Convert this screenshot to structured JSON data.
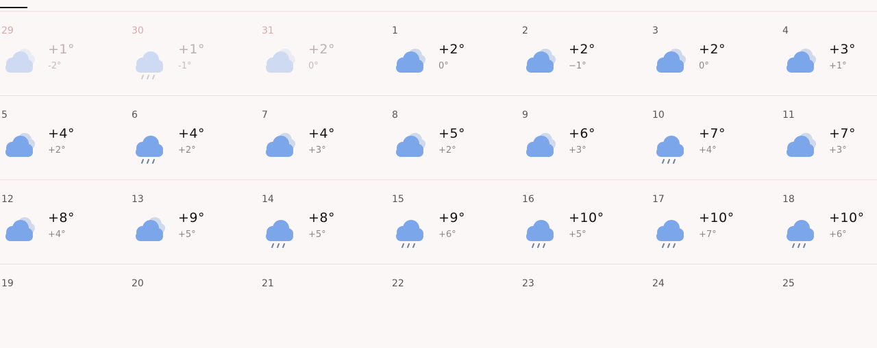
{
  "weeks": [
    [
      {
        "day": "29",
        "max": "+1°",
        "min": "-2°",
        "icon": "cloudy-icon",
        "past": true
      },
      {
        "day": "30",
        "max": "+1°",
        "min": "-1°",
        "icon": "rain-cloud-icon",
        "past": true
      },
      {
        "day": "31",
        "max": "+2°",
        "min": "0°",
        "icon": "cloudy-icon",
        "past": true
      },
      {
        "day": "1",
        "max": "+2°",
        "min": "0°",
        "icon": "cloudy-icon",
        "past": false
      },
      {
        "day": "2",
        "max": "+2°",
        "min": "−1°",
        "icon": "cloudy-icon",
        "past": false
      },
      {
        "day": "3",
        "max": "+2°",
        "min": "0°",
        "icon": "cloudy-icon",
        "past": false
      },
      {
        "day": "4",
        "max": "+3°",
        "min": "+1°",
        "icon": "cloudy-icon",
        "past": false
      }
    ],
    [
      {
        "day": "5",
        "max": "+4°",
        "min": "+2°",
        "icon": "cloudy-icon",
        "past": false
      },
      {
        "day": "6",
        "max": "+4°",
        "min": "+2°",
        "icon": "rain-cloud-icon",
        "past": false
      },
      {
        "day": "7",
        "max": "+4°",
        "min": "+3°",
        "icon": "cloudy-icon",
        "past": false
      },
      {
        "day": "8",
        "max": "+5°",
        "min": "+2°",
        "icon": "cloudy-icon",
        "past": false
      },
      {
        "day": "9",
        "max": "+6°",
        "min": "+3°",
        "icon": "cloudy-icon",
        "past": false
      },
      {
        "day": "10",
        "max": "+7°",
        "min": "+4°",
        "icon": "rain-cloud-icon",
        "past": false
      },
      {
        "day": "11",
        "max": "+7°",
        "min": "+3°",
        "icon": "cloudy-icon",
        "past": false
      }
    ],
    [
      {
        "day": "12",
        "max": "+8°",
        "min": "+4°",
        "icon": "cloudy-icon",
        "past": false
      },
      {
        "day": "13",
        "max": "+9°",
        "min": "+5°",
        "icon": "cloudy-icon",
        "past": false
      },
      {
        "day": "14",
        "max": "+8°",
        "min": "+5°",
        "icon": "rain-cloud-icon",
        "past": false
      },
      {
        "day": "15",
        "max": "+9°",
        "min": "+6°",
        "icon": "rain-cloud-icon",
        "past": false
      },
      {
        "day": "16",
        "max": "+10°",
        "min": "+5°",
        "icon": "rain-cloud-icon",
        "past": false
      },
      {
        "day": "17",
        "max": "+10°",
        "min": "+7°",
        "icon": "rain-cloud-icon",
        "past": false
      },
      {
        "day": "18",
        "max": "+10°",
        "min": "+6°",
        "icon": "rain-cloud-icon",
        "past": false
      }
    ],
    [
      {
        "day": "19",
        "max": "",
        "min": "",
        "icon": "",
        "past": false
      },
      {
        "day": "20",
        "max": "",
        "min": "",
        "icon": "",
        "past": false
      },
      {
        "day": "21",
        "max": "",
        "min": "",
        "icon": "",
        "past": false
      },
      {
        "day": "22",
        "max": "",
        "min": "",
        "icon": "",
        "past": false
      },
      {
        "day": "23",
        "max": "",
        "min": "",
        "icon": "",
        "past": false
      },
      {
        "day": "24",
        "max": "",
        "min": "",
        "icon": "",
        "past": false
      },
      {
        "day": "25",
        "max": "",
        "min": "",
        "icon": "",
        "past": false
      }
    ]
  ],
  "colors": {
    "cloud_front": "#7ba6ea",
    "cloud_back": "#cfd9ec",
    "rain": "#6e7f99"
  }
}
